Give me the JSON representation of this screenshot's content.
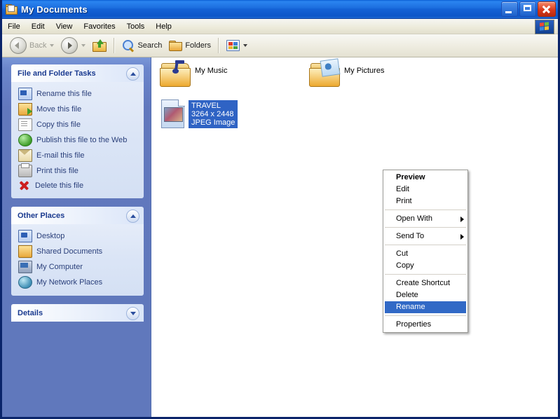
{
  "window": {
    "title": "My Documents",
    "title_icon": "folder-document-icon",
    "controls": {
      "minimize": "Minimize",
      "maximize": "Maximize",
      "close": "Close"
    }
  },
  "menubar": {
    "items": [
      {
        "label": "File"
      },
      {
        "label": "Edit"
      },
      {
        "label": "View"
      },
      {
        "label": "Favorites"
      },
      {
        "label": "Tools"
      },
      {
        "label": "Help"
      }
    ],
    "brand_icon": "windows-flag-icon"
  },
  "toolbar": {
    "back": {
      "label": "Back",
      "icon": "back-arrow-icon",
      "enabled": false
    },
    "forward": {
      "icon": "forward-arrow-icon",
      "enabled": true
    },
    "up": {
      "icon": "up-folder-icon"
    },
    "search": {
      "label": "Search",
      "icon": "magnifier-icon"
    },
    "folders": {
      "label": "Folders",
      "icon": "folder-icon"
    },
    "views": {
      "icon": "views-grid-icon"
    }
  },
  "sidebar": {
    "panels": [
      {
        "title": "File and Folder Tasks",
        "collapse_icon": "chevron-up-icon",
        "collapsed": false,
        "items": [
          {
            "label": "Rename this file",
            "icon": "rename-icon"
          },
          {
            "label": "Move this file",
            "icon": "move-icon"
          },
          {
            "label": "Copy this file",
            "icon": "copy-icon"
          },
          {
            "label": "Publish this file to the Web",
            "icon": "publish-globe-icon"
          },
          {
            "label": "E-mail this file",
            "icon": "email-icon"
          },
          {
            "label": "Print this file",
            "icon": "print-icon"
          },
          {
            "label": "Delete this file",
            "icon": "delete-x-icon"
          }
        ]
      },
      {
        "title": "Other Places",
        "collapse_icon": "chevron-up-icon",
        "collapsed": false,
        "items": [
          {
            "label": "Desktop",
            "icon": "desktop-icon"
          },
          {
            "label": "Shared Documents",
            "icon": "shared-folder-icon"
          },
          {
            "label": "My Computer",
            "icon": "my-computer-icon"
          },
          {
            "label": "My Network Places",
            "icon": "network-places-icon"
          }
        ]
      },
      {
        "title": "Details",
        "collapse_icon": "chevron-down-icon",
        "collapsed": true,
        "items": []
      }
    ]
  },
  "content": {
    "items": [
      {
        "name": "My Music",
        "icon": "folder-music-icon",
        "type": "folder",
        "selected": false
      },
      {
        "name": "My Pictures",
        "icon": "folder-pictures-icon",
        "type": "folder",
        "selected": false
      },
      {
        "name": "TRAVEL",
        "icon": "jpeg-file-icon",
        "type": "file",
        "selected": true,
        "dimensions": "3264 x 2448",
        "file_type": "JPEG Image"
      }
    ]
  },
  "context_menu": {
    "groups": [
      [
        {
          "label": "Preview",
          "bold": true,
          "selected": false,
          "submenu": false
        },
        {
          "label": "Edit",
          "bold": false,
          "selected": false,
          "submenu": false
        },
        {
          "label": "Print",
          "bold": false,
          "selected": false,
          "submenu": false
        }
      ],
      [
        {
          "label": "Open With",
          "bold": false,
          "selected": false,
          "submenu": true
        }
      ],
      [
        {
          "label": "Send To",
          "bold": false,
          "selected": false,
          "submenu": true
        }
      ],
      [
        {
          "label": "Cut",
          "bold": false,
          "selected": false,
          "submenu": false
        },
        {
          "label": "Copy",
          "bold": false,
          "selected": false,
          "submenu": false
        }
      ],
      [
        {
          "label": "Create Shortcut",
          "bold": false,
          "selected": false,
          "submenu": false
        },
        {
          "label": "Delete",
          "bold": false,
          "selected": false,
          "submenu": false
        },
        {
          "label": "Rename",
          "bold": false,
          "selected": true,
          "submenu": false
        }
      ],
      [
        {
          "label": "Properties",
          "bold": false,
          "selected": false,
          "submenu": false
        }
      ]
    ]
  },
  "colors": {
    "titlebar_blue": "#1462d6",
    "sidebar_blue": "#6078bc",
    "panel_body": "#dbe5f6",
    "panel_title_text": "#1a3a8f",
    "selection_blue": "#3169c6",
    "link_text": "#2a3f7a",
    "close_red": "#d93a1c"
  }
}
